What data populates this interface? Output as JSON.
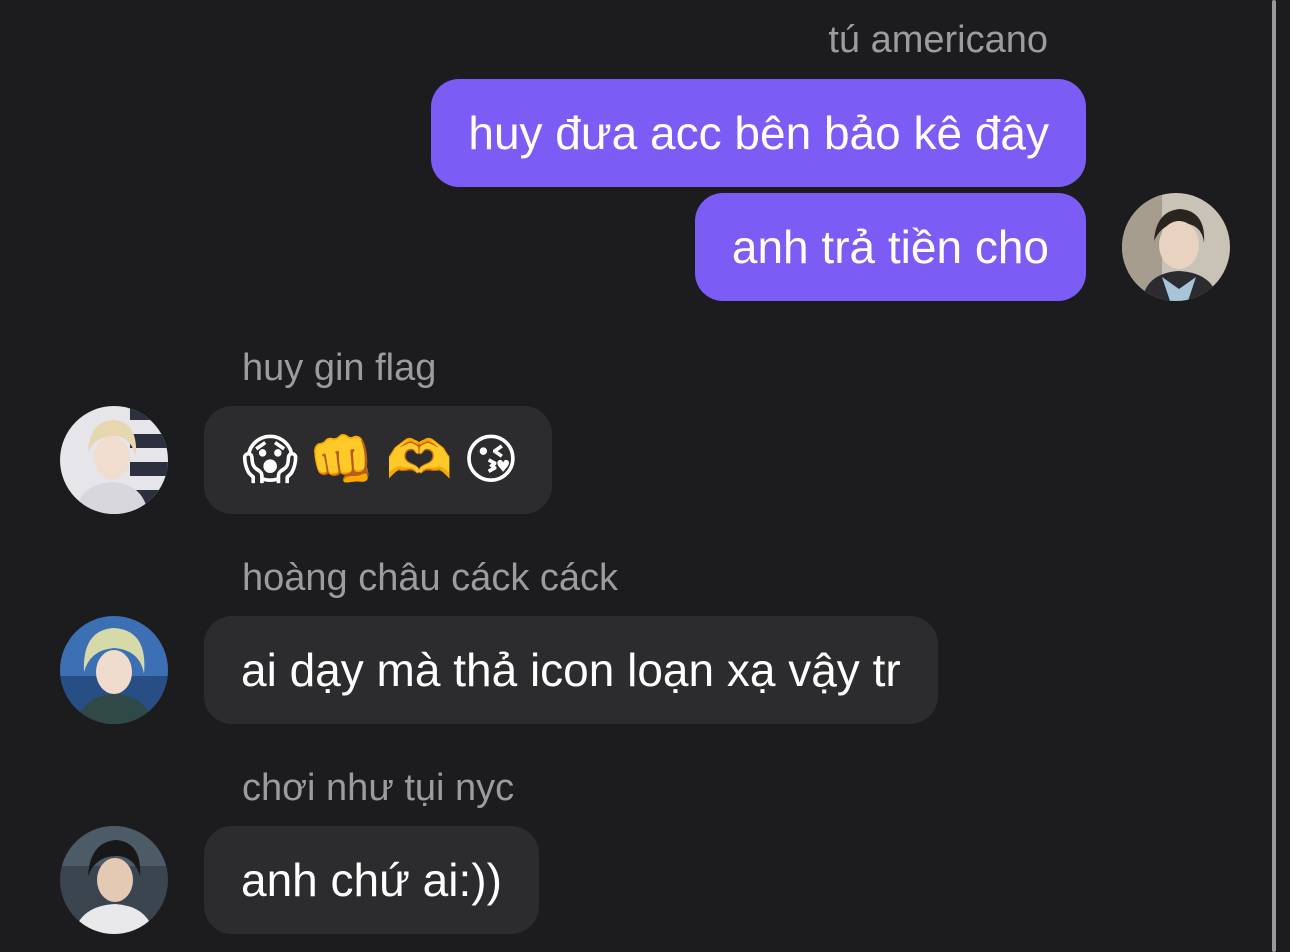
{
  "thread": {
    "outgoing_group": {
      "sender": "tú americano",
      "messages": [
        "huy đưa acc bên bảo kê đây",
        "anh trả tiền cho"
      ],
      "avatar_icon": "user-avatar-photo"
    },
    "incoming": [
      {
        "sender": "huy gin flag",
        "emojis": [
          "😱",
          "👊",
          "🫶",
          "😘"
        ],
        "avatar_icon": "user-avatar-photo"
      },
      {
        "sender": "hoàng châu cáck cáck",
        "message": "ai dạy mà thả icon loạn xạ vậy tr",
        "avatar_icon": "user-avatar-photo"
      },
      {
        "sender": "chơi như tụi nyc",
        "message": "anh chứ ai:))",
        "avatar_icon": "user-avatar-photo"
      }
    ]
  },
  "colors": {
    "background": "#1c1c1e",
    "outgoing_bubble": "#7b5cf5",
    "incoming_bubble": "#2c2c2e",
    "sender_name": "#9b9ba0",
    "message_text": "#ffffff"
  }
}
